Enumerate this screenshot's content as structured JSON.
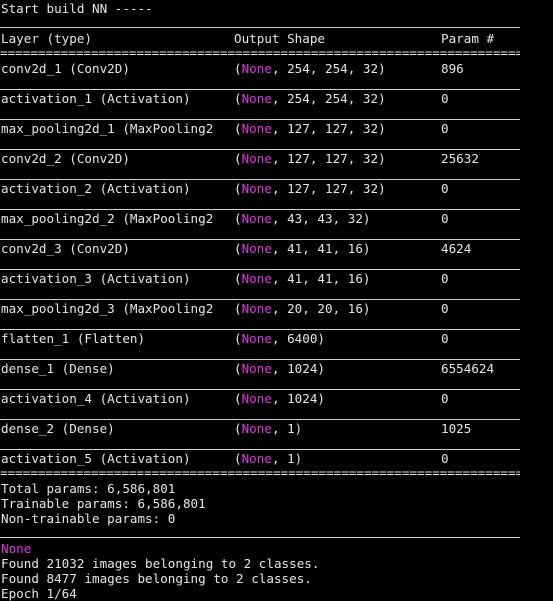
{
  "title_line": "Start build NN -----",
  "header": {
    "layer": "Layer (type)",
    "output_shape": "Output Shape",
    "param": "Param #"
  },
  "separator_eq": "==================================================================================",
  "layers": [
    {
      "name": "conv2d_1 (Conv2D)",
      "shape_open": "(",
      "shape_none": "None",
      "shape_rest": ", 254, 254, 32)",
      "params": "896"
    },
    {
      "name": "activation_1 (Activation)",
      "shape_open": "(",
      "shape_none": "None",
      "shape_rest": ", 254, 254, 32)",
      "params": "0"
    },
    {
      "name": "max_pooling2d_1 (MaxPooling2",
      "shape_open": "(",
      "shape_none": "None",
      "shape_rest": ", 127, 127, 32)",
      "params": "0"
    },
    {
      "name": "conv2d_2 (Conv2D)",
      "shape_open": "(",
      "shape_none": "None",
      "shape_rest": ", 127, 127, 32)",
      "params": "25632"
    },
    {
      "name": "activation_2 (Activation)",
      "shape_open": "(",
      "shape_none": "None",
      "shape_rest": ", 127, 127, 32)",
      "params": "0"
    },
    {
      "name": "max_pooling2d_2 (MaxPooling2",
      "shape_open": "(",
      "shape_none": "None",
      "shape_rest": ", 43, 43, 32)",
      "params": "0"
    },
    {
      "name": "conv2d_3 (Conv2D)",
      "shape_open": "(",
      "shape_none": "None",
      "shape_rest": ", 41, 41, 16)",
      "params": "4624"
    },
    {
      "name": "activation_3 (Activation)",
      "shape_open": "(",
      "shape_none": "None",
      "shape_rest": ", 41, 41, 16)",
      "params": "0"
    },
    {
      "name": "max_pooling2d_3 (MaxPooling2",
      "shape_open": "(",
      "shape_none": "None",
      "shape_rest": ", 20, 20, 16)",
      "params": "0"
    },
    {
      "name": "flatten_1 (Flatten)",
      "shape_open": "(",
      "shape_none": "None",
      "shape_rest": ", 6400)",
      "params": "0"
    },
    {
      "name": "dense_1 (Dense)",
      "shape_open": "(",
      "shape_none": "None",
      "shape_rest": ", 1024)",
      "params": "6554624"
    },
    {
      "name": "activation_4 (Activation)",
      "shape_open": "(",
      "shape_none": "None",
      "shape_rest": ", 1024)",
      "params": "0"
    },
    {
      "name": "dense_2 (Dense)",
      "shape_open": "(",
      "shape_none": "None",
      "shape_rest": ", 1)",
      "params": "1025"
    },
    {
      "name": "activation_5 (Activation)",
      "shape_open": "(",
      "shape_none": "None",
      "shape_rest": ", 1)",
      "params": "0"
    }
  ],
  "totals": {
    "total": "Total params: 6,586,801",
    "trainable": "Trainable params: 6,586,801",
    "non_trainable": "Non-trainable params: 0"
  },
  "footer": {
    "none_line": "None",
    "found_train": "Found 21032 images belonging to 2 classes.",
    "found_val": "Found 8477 images belonging to 2 classes.",
    "epoch_partial": "Epoch 1/64"
  },
  "colors": {
    "background": "#000000",
    "text": "#e6e6e6",
    "none_highlight": "#d83ad8"
  }
}
